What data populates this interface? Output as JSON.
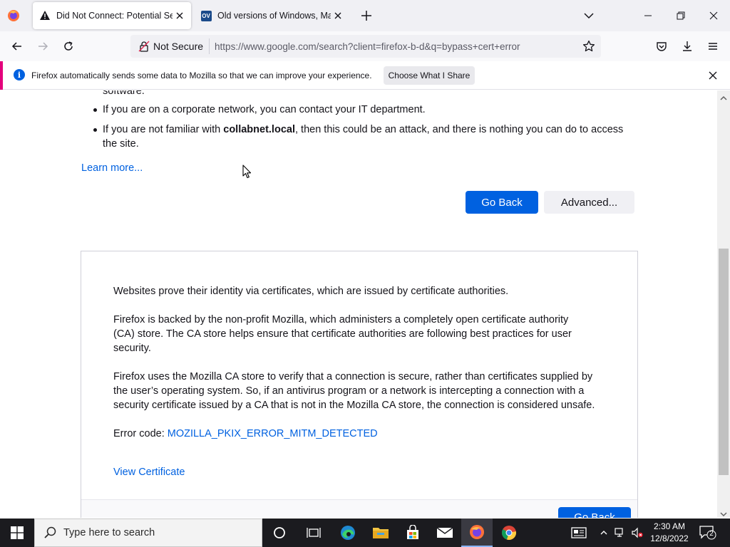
{
  "tabs": [
    {
      "title": "Did Not Connect: Potential Security Issue",
      "icon": "warning-icon",
      "active": true
    },
    {
      "title": "Old versions of Windows, Mac and Linux",
      "icon": "ov-site-icon",
      "badge": "OV",
      "active": false
    }
  ],
  "navbar": {
    "security_label": "Not Secure",
    "url": "https://www.google.com/search?client=firefox-b-d&q=bypass+cert+error"
  },
  "notification": {
    "text": "Firefox automatically sends some data to Mozilla so that we can improve your experience.",
    "button": "Choose What I Share"
  },
  "content": {
    "partial_line": "software.",
    "bullet1": "If you are on a corporate network, you can contact your IT department.",
    "bullet2_prefix": "If you are not familiar with ",
    "bullet2_host": "collabnet.local",
    "bullet2_line1_suffix": ", then this could be an attack, and there is nothing you can do to access",
    "bullet2_line2": "the site.",
    "learn_more": "Learn more...",
    "go_back": "Go Back",
    "advanced": "Advanced..."
  },
  "advanced_panel": {
    "p1": "Websites prove their identity via certificates, which are issued by certificate authorities.",
    "p2_line1": "Firefox is backed by the non-profit Mozilla, which administers a completely open certificate authority",
    "p2_line2": "(CA) store. The CA store helps ensure that certificate authorities are following best practices for user",
    "p2_line3": "security.",
    "p3_line1": "Firefox uses the Mozilla CA store to verify that a connection is secure, rather than certificates supplied by",
    "p3_line2": "the user’s operating system. So, if an antivirus program or a network is intercepting a connection with a",
    "p3_line3": "security certificate issued by a CA that is not in the Mozilla CA store, the connection is considered unsafe.",
    "error_label": "Error code: ",
    "error_code": "MOZILLA_PKIX_ERROR_MITM_DETECTED",
    "view_certificate": "View Certificate",
    "go_back_bottom": "Go Back"
  },
  "taskbar": {
    "search_placeholder": "Type here to search",
    "time": "2:30 AM",
    "date": "12/8/2022",
    "notification_count": "2"
  },
  "colors": {
    "accent_blue": "#0061e0",
    "notification_accent": "#e4007c",
    "taskbar": "#1b1b1f"
  }
}
